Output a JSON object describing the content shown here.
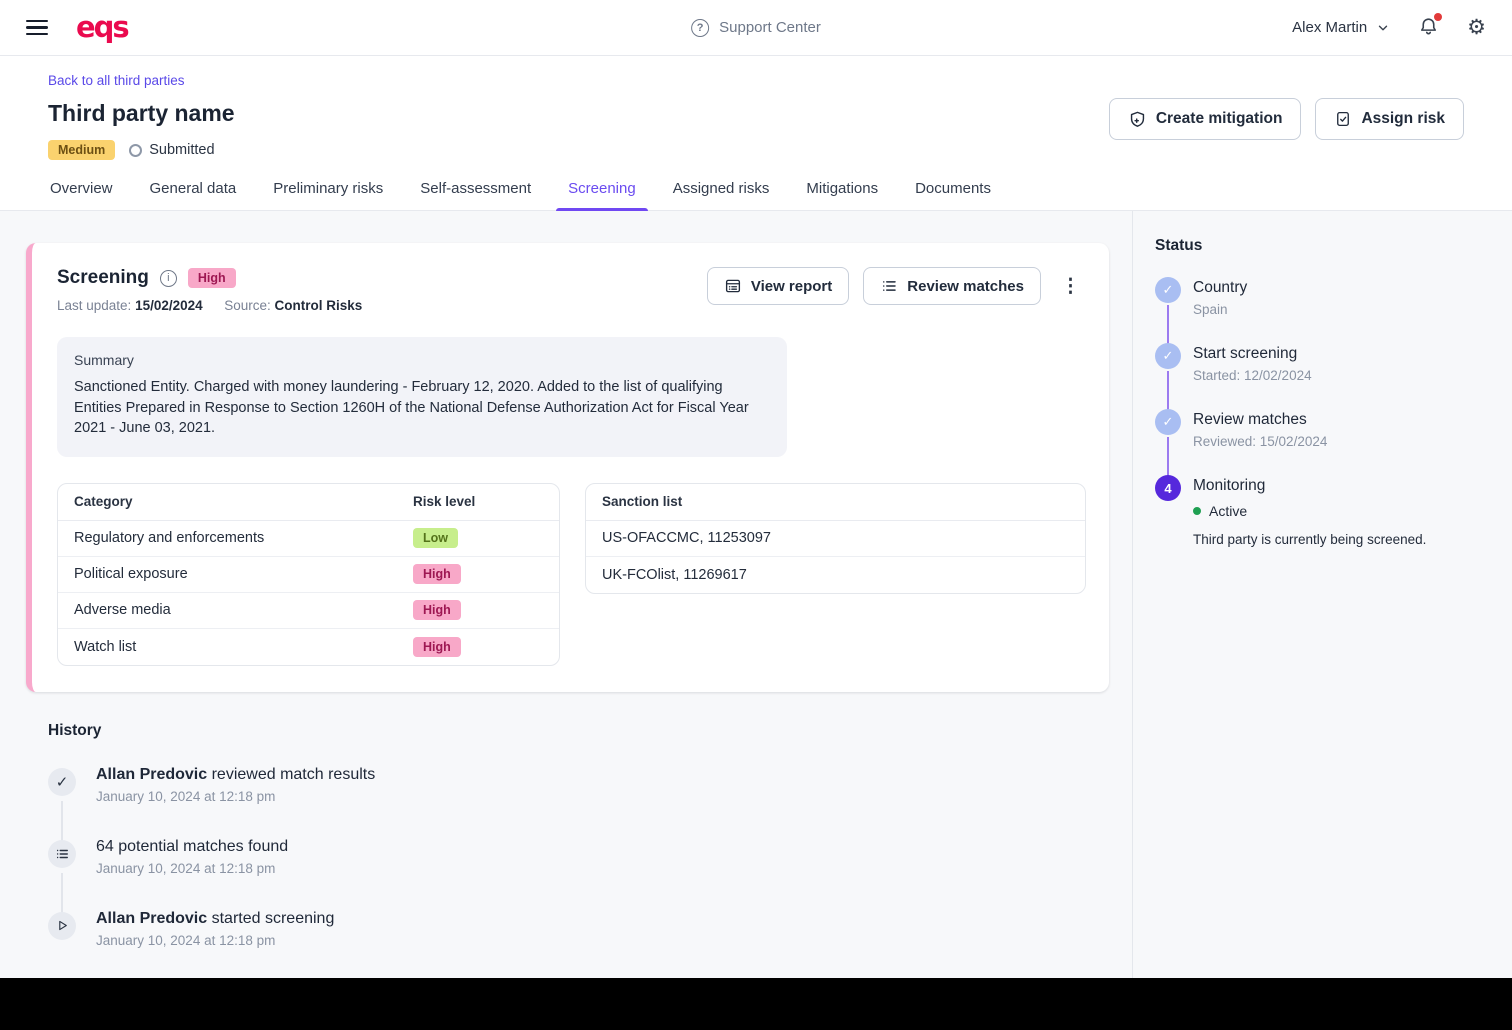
{
  "topbar": {
    "logo": "eqs",
    "support_center": "Support Center",
    "user_name": "Alex Martin"
  },
  "header": {
    "back_link": "Back to all third parties",
    "title": "Third party name",
    "risk_badge": "Medium",
    "status": "Submitted",
    "create_mitigation": "Create mitigation",
    "assign_risk": "Assign risk"
  },
  "tabs": {
    "active": "Screening",
    "items": [
      {
        "label": "Overview"
      },
      {
        "label": "General data"
      },
      {
        "label": "Preliminary risks"
      },
      {
        "label": "Self-assessment"
      },
      {
        "label": "Screening"
      },
      {
        "label": "Assigned risks"
      },
      {
        "label": "Mitigations"
      },
      {
        "label": "Documents"
      }
    ]
  },
  "screening_card": {
    "title": "Screening",
    "badge": "High",
    "last_update_label": "Last update:",
    "last_update_value": "15/02/2024",
    "source_label": "Source:",
    "source_value": "Control Risks",
    "view_report": "View report",
    "review_matches": "Review matches",
    "summary_label": "Summary",
    "summary_text": "Sanctioned Entity. Charged with money laundering - February 12, 2020. Added to the list of qualifying Entities Prepared in Response to Section 1260H of the National Defense Authorization Act for Fiscal Year 2021 - June 03, 2021.",
    "category_table": {
      "headers": [
        "Category",
        "Risk level"
      ],
      "rows": [
        {
          "category": "Regulatory and enforcements",
          "risk": "Low",
          "risk_color": "green"
        },
        {
          "category": "Political exposure",
          "risk": "High",
          "risk_color": "pink"
        },
        {
          "category": "Adverse media",
          "risk": "High",
          "risk_color": "pink"
        },
        {
          "category": "Watch list",
          "risk": "High",
          "risk_color": "pink"
        }
      ]
    },
    "sanction_table": {
      "header": "Sanction list",
      "rows": [
        {
          "value": "US-OFACCMC, 11253097"
        },
        {
          "value": "UK-FCOlist, 11269617"
        }
      ]
    }
  },
  "status_panel": {
    "title": "Status",
    "steps": [
      {
        "label": "Country",
        "sub": "Spain",
        "state": "done"
      },
      {
        "label": "Start screening",
        "sub": "Started: 12/02/2024",
        "state": "done"
      },
      {
        "label": "Review matches",
        "sub": "Reviewed: 15/02/2024",
        "state": "done"
      },
      {
        "label": "Monitoring",
        "number": "4",
        "state": "current",
        "status_text": "Active",
        "description": "Third party is currently being screened."
      }
    ]
  },
  "history": {
    "title": "History",
    "items": [
      {
        "actor": "Allan Predovic",
        "action": " reviewed match results",
        "timestamp": "January 10, 2024 at 12:18 pm",
        "icon": "check"
      },
      {
        "actor": "",
        "action": "64 potential matches found",
        "timestamp": "January 10, 2024 at 12:18 pm",
        "icon": "list"
      },
      {
        "actor": "Allan Predovic",
        "action": " started screening",
        "timestamp": "January 10, 2024 at 12:18 pm",
        "icon": "play"
      }
    ]
  },
  "icons": {
    "check_glyph": "✓",
    "kebab_glyph": "⋮",
    "gear_glyph": "⚙",
    "help_glyph": "?",
    "info_glyph": "i"
  },
  "colors": {
    "brand_red": "#EA0A4E",
    "accent_purple": "#6A4BF0",
    "link_purple": "#5A49E8",
    "card_accent_pink": "#F8A9CC",
    "badge_medium_bg": "#FAD26E",
    "badge_high_bg": "#F8A8C8",
    "badge_high_text": "#9E1853",
    "badge_low_bg": "#C7EE8C",
    "badge_low_text": "#54731A",
    "timeline_done": "#A9BEF2",
    "timeline_current": "#5628DC",
    "timeline_connector": "#9C7BF0",
    "active_green": "#1FA052",
    "page_bg": "#F7F8FA"
  }
}
